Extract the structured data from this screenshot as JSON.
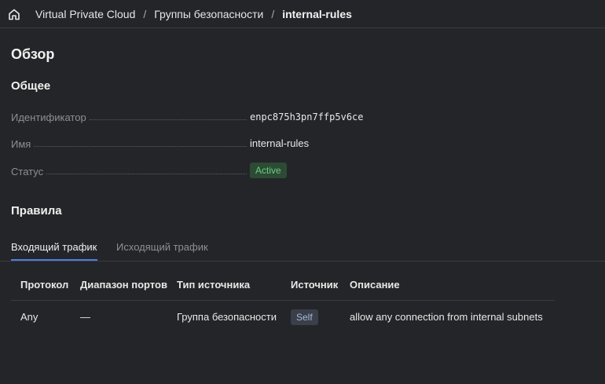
{
  "breadcrumbs": {
    "home_icon": "home-icon",
    "items": [
      "Virtual Private Cloud",
      "Группы безопасности",
      "internal-rules"
    ],
    "separator": "/"
  },
  "overview": {
    "title": "Обзор",
    "general": {
      "title": "Общее",
      "id_label": "Идентификатор",
      "id_value": "enpc875h3pn7ffp5v6ce",
      "name_label": "Имя",
      "name_value": "internal-rules",
      "status_label": "Статус",
      "status_value": "Active",
      "status_color": "#6ad07f"
    }
  },
  "rules": {
    "title": "Правила",
    "tabs": [
      "Входящий трафик",
      "Исходящий трафик"
    ],
    "active_tab": "Входящий трафик",
    "columns": [
      "Протокол",
      "Диапазон портов",
      "Тип источника",
      "Источник",
      "Описание"
    ],
    "rows": [
      {
        "protocol": "Any",
        "ports": "—",
        "source_type": "Группа безопасности",
        "source": "Self",
        "description": "allow any connection from internal subnets"
      }
    ]
  },
  "colors": {
    "background": "#242528",
    "accent": "#4a7fe4"
  }
}
